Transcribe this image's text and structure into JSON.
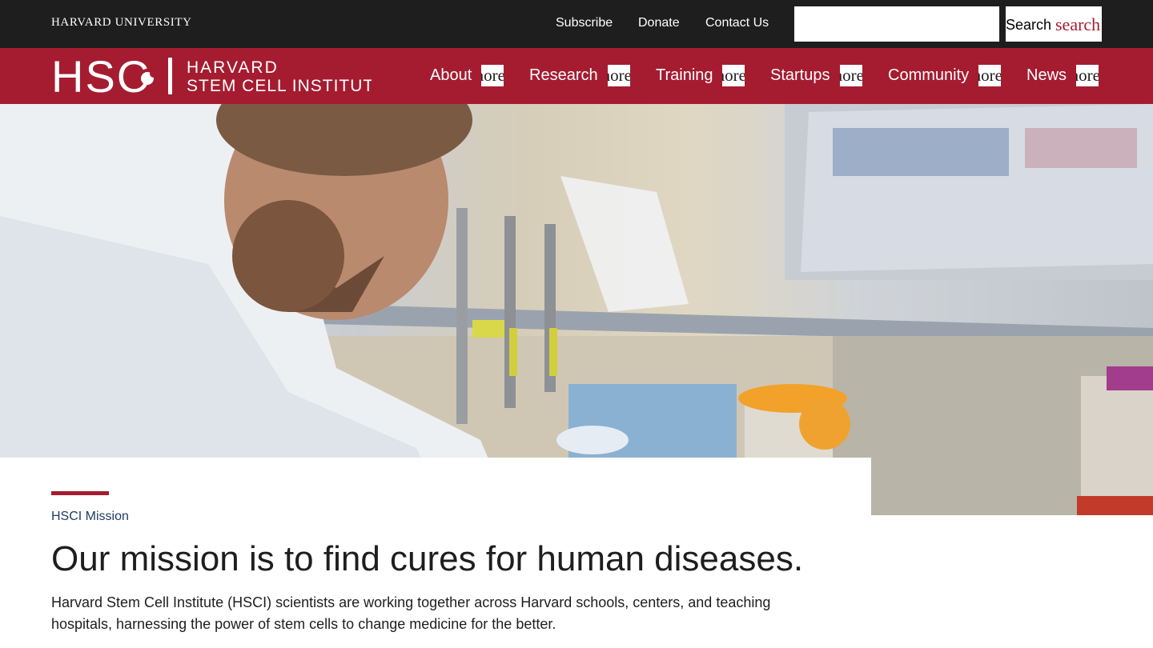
{
  "topbar": {
    "university": "HARVARD UNIVERSITY",
    "links": [
      "Subscribe",
      "Donate",
      "Contact Us"
    ],
    "search": {
      "value": "",
      "button_label": "Search",
      "button_icon_text": "search"
    }
  },
  "header": {
    "logo": {
      "mark": "HSC",
      "line1": "HARVARD",
      "line2": "STEM CELL INSTITUTE"
    },
    "nav": [
      {
        "label": "About",
        "expand_text": "expand_more"
      },
      {
        "label": "Research",
        "expand_text": "expand_more"
      },
      {
        "label": "Training",
        "expand_text": "expand_more"
      },
      {
        "label": "Startups",
        "expand_text": "expand_more"
      },
      {
        "label": "Community",
        "expand_text": "expand_more"
      },
      {
        "label": "News",
        "expand_text": "expand_more"
      }
    ]
  },
  "mission": {
    "eyebrow": "HSCI Mission",
    "headline": "Our mission is to find cures for human diseases.",
    "body": "Harvard Stem Cell Institute (HSCI) scientists are working together across Harvard schools, centers, and teaching hospitals, harnessing the power of stem cells to change medicine for the better."
  },
  "colors": {
    "crimson": "#a51c30",
    "topbar": "#1e1e1e",
    "eyebrow": "#1e3a5f"
  }
}
